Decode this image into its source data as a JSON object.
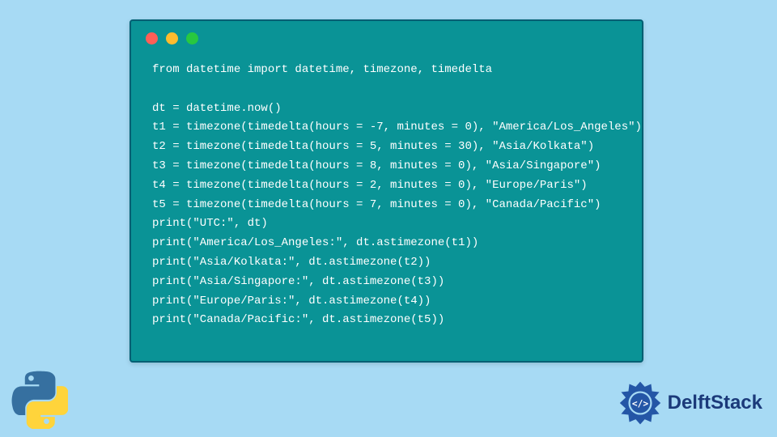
{
  "code": {
    "lines": [
      "from datetime import datetime, timezone, timedelta",
      "",
      "dt = datetime.now()",
      "t1 = timezone(timedelta(hours = -7, minutes = 0), \"America/Los_Angeles\")",
      "t2 = timezone(timedelta(hours = 5, minutes = 30), \"Asia/Kolkata\")",
      "t3 = timezone(timedelta(hours = 8, minutes = 0), \"Asia/Singapore\")",
      "t4 = timezone(timedelta(hours = 2, minutes = 0), \"Europe/Paris\")",
      "t5 = timezone(timedelta(hours = 7, minutes = 0), \"Canada/Pacific\")",
      "print(\"UTC:\", dt)",
      "print(\"America/Los_Angeles:\", dt.astimezone(t1))",
      "print(\"Asia/Kolkata:\", dt.astimezone(t2))",
      "print(\"Asia/Singapore:\", dt.astimezone(t3))",
      "print(\"Europe/Paris:\", dt.astimezone(t4))",
      "print(\"Canada/Pacific:\", dt.astimezone(t5))"
    ]
  },
  "brand": {
    "name": "DelftStack"
  },
  "colors": {
    "page_bg": "#a7daf4",
    "panel_bg": "#0a9396",
    "panel_border": "#005f73",
    "code_text": "#ffffff",
    "brand_text": "#1b3a7a"
  }
}
